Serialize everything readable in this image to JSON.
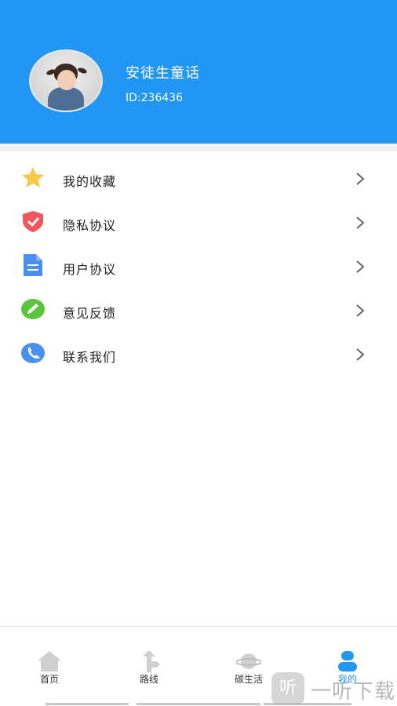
{
  "profile": {
    "username": "安徒生童话",
    "user_id": "ID:236436"
  },
  "menu": {
    "items": [
      {
        "label": "我的收藏",
        "icon": "star-icon",
        "color": "#f7c948"
      },
      {
        "label": "隐私协议",
        "icon": "shield-icon",
        "color": "#f0575a"
      },
      {
        "label": "用户协议",
        "icon": "document-icon",
        "color": "#4a8ef0"
      },
      {
        "label": "意见反馈",
        "icon": "pencil-icon",
        "color": "#5ac43a"
      },
      {
        "label": "联系我们",
        "icon": "phone-icon",
        "color": "#4a8ef0"
      }
    ]
  },
  "tabbar": {
    "tabs": [
      {
        "label": "首页",
        "icon": "home-icon"
      },
      {
        "label": "路线",
        "icon": "signpost-icon"
      },
      {
        "label": "碳生活",
        "icon": "planet-icon"
      },
      {
        "label": "我的",
        "icon": "user-icon"
      }
    ],
    "active_index": 3
  },
  "watermark": {
    "icon_glyph": "听",
    "text": "一听下载"
  },
  "colors": {
    "header_bg": "#2196f3",
    "active_tab": "#2196f3",
    "inactive_icon": "#d0d0d0"
  }
}
